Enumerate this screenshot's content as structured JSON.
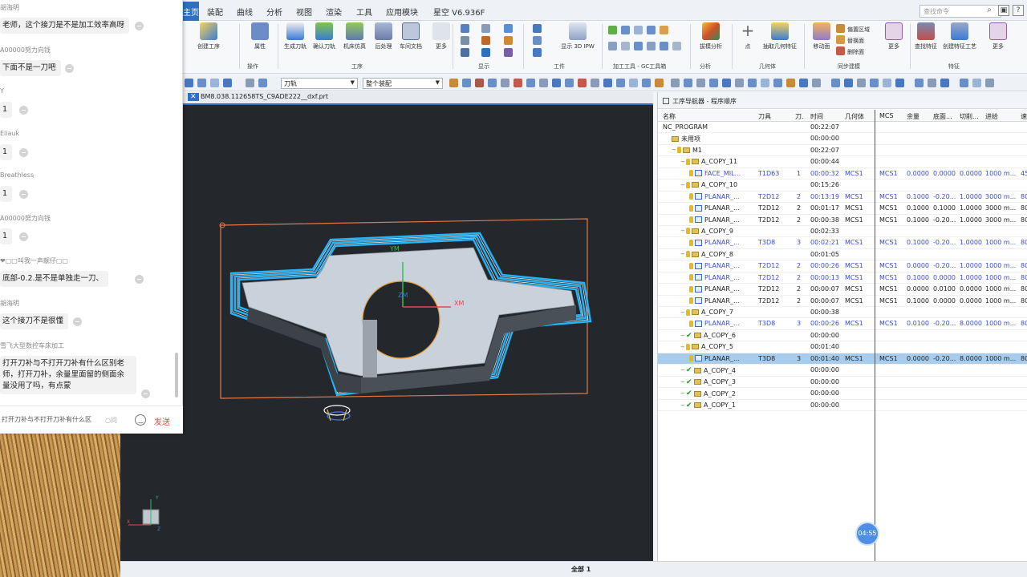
{
  "app": {
    "menu": [
      "主页",
      "装配",
      "曲线",
      "分析",
      "视图",
      "渲染",
      "工具",
      "应用模块",
      "星空 V6.936F"
    ],
    "search_placeholder": "查找命令",
    "ribbon_buttons": [
      "创建工序",
      "属性",
      "生成刀轨",
      "确认刀轨",
      "机床仿真",
      "后处理",
      "车间文档",
      "更多",
      "显示 3D IPW",
      "拔模分析",
      "点",
      "抽取几何特征",
      "移动面",
      "替换面",
      "删除面",
      "偏置区域",
      "更多",
      "查找特征",
      "创建特征工艺",
      "更多"
    ],
    "ribbon_groups": [
      "操作",
      "工序",
      "显示",
      "工件",
      "加工工具 - GC工具箱",
      "分析",
      "几何体",
      "同步建模",
      "特征"
    ],
    "toolbar_select_1": "刀轨",
    "toolbar_select_2": "整个装配",
    "doc_tab": "BM8.038.112658TS_C9ADE222__dxf.prt",
    "status": "全部 1",
    "timer": "04:55"
  },
  "navigator": {
    "title": "工序导航器 - 程序顺序",
    "columns": [
      "名称",
      "刀具",
      "刀.",
      "时间",
      "几何体",
      "MCS",
      "余量",
      "底面...",
      "切削...",
      "进给",
      "速"
    ],
    "rows": [
      {
        "name": "NC_PROGRAM",
        "lvl": 0,
        "icon": "none",
        "tool": "",
        "num": "",
        "time": "00:22:07",
        "geom": "",
        "mcs": "",
        "stock": "",
        "floor": "",
        "cut": "",
        "feed": "",
        "speed": ""
      },
      {
        "name": "未用项",
        "lvl": 1,
        "icon": "fold",
        "tool": "",
        "num": "",
        "time": "00:00:00",
        "geom": "",
        "mcs": "",
        "stock": "",
        "floor": "",
        "cut": "",
        "feed": "",
        "speed": ""
      },
      {
        "name": "M1",
        "lvl": 1,
        "icon": "keyfold",
        "tool": "",
        "num": "",
        "time": "00:22:07",
        "geom": "",
        "mcs": "",
        "stock": "",
        "floor": "",
        "cut": "",
        "feed": "",
        "speed": ""
      },
      {
        "name": "A_COPY_11",
        "lvl": 2,
        "icon": "keyfold",
        "tool": "",
        "num": "",
        "time": "00:00:44",
        "geom": "",
        "mcs": "",
        "stock": "",
        "floor": "",
        "cut": "",
        "feed": "",
        "speed": ""
      },
      {
        "name": "FACE_MIL...",
        "lvl": 3,
        "icon": "keyop",
        "blue": true,
        "tool": "T1D63",
        "num": "1",
        "time": "00:00:32",
        "geom": "MCS1",
        "mcs": "MCS1",
        "stock": "0.0000",
        "floor": "0.0000",
        "cut": "0.0000",
        "feed": "1000 m...",
        "speed": "45"
      },
      {
        "name": "A_COPY_10",
        "lvl": 2,
        "icon": "keyfold",
        "tool": "",
        "num": "",
        "time": "00:15:26",
        "geom": "",
        "mcs": "",
        "stock": "",
        "floor": "",
        "cut": "",
        "feed": "",
        "speed": ""
      },
      {
        "name": "PLANAR_...",
        "lvl": 3,
        "icon": "keyop",
        "blue": true,
        "tool": "T2D12",
        "num": "2",
        "time": "00:13:19",
        "geom": "MCS1",
        "mcs": "MCS1",
        "stock": "0.1000",
        "floor": "-0.20...",
        "cut": "1.0000",
        "feed": "3000 m...",
        "speed": "80"
      },
      {
        "name": "PLANAR_...",
        "lvl": 3,
        "icon": "keyop",
        "tool": "T2D12",
        "num": "2",
        "time": "00:01:17",
        "geom": "MCS1",
        "mcs": "MCS1",
        "stock": "0.1000",
        "floor": "0.1000",
        "cut": "1.0000",
        "feed": "3000 m...",
        "speed": "80"
      },
      {
        "name": "PLANAR_...",
        "lvl": 3,
        "icon": "keyop",
        "tool": "T2D12",
        "num": "2",
        "time": "00:00:38",
        "geom": "MCS1",
        "mcs": "MCS1",
        "stock": "0.1000",
        "floor": "-0.20...",
        "cut": "1.0000",
        "feed": "3000 m...",
        "speed": "80"
      },
      {
        "name": "A_COPY_9",
        "lvl": 2,
        "icon": "keyfold",
        "tool": "",
        "num": "",
        "time": "00:02:33",
        "geom": "",
        "mcs": "",
        "stock": "",
        "floor": "",
        "cut": "",
        "feed": "",
        "speed": ""
      },
      {
        "name": "PLANAR_...",
        "lvl": 3,
        "icon": "keyop",
        "blue": true,
        "tool": "T3D8",
        "num": "3",
        "time": "00:02:21",
        "geom": "MCS1",
        "mcs": "MCS1",
        "stock": "0.1000",
        "floor": "-0.20...",
        "cut": "1.0000",
        "feed": "1000 m...",
        "speed": "80"
      },
      {
        "name": "A_COPY_8",
        "lvl": 2,
        "icon": "keyfold",
        "tool": "",
        "num": "",
        "time": "00:01:05",
        "geom": "",
        "mcs": "",
        "stock": "",
        "floor": "",
        "cut": "",
        "feed": "",
        "speed": ""
      },
      {
        "name": "PLANAR_...",
        "lvl": 3,
        "icon": "keyop",
        "blue": true,
        "tool": "T2D12",
        "num": "2",
        "time": "00:00:26",
        "geom": "MCS1",
        "mcs": "MCS1",
        "stock": "0.0000",
        "floor": "-0.20...",
        "cut": "1.0000",
        "feed": "1000 m...",
        "speed": "80"
      },
      {
        "name": "PLANAR_...",
        "lvl": 3,
        "icon": "keyop",
        "blue": true,
        "tool": "T2D12",
        "num": "2",
        "time": "00:00:13",
        "geom": "MCS1",
        "mcs": "MCS1",
        "stock": "0.1000",
        "floor": "0.0000",
        "cut": "1.0000",
        "feed": "1000 m...",
        "speed": "80"
      },
      {
        "name": "PLANAR_...",
        "lvl": 3,
        "icon": "keyop",
        "tool": "T2D12",
        "num": "2",
        "time": "00:00:07",
        "geom": "MCS1",
        "mcs": "MCS1",
        "stock": "0.0000",
        "floor": "0.0100",
        "cut": "0.0000",
        "feed": "1000 m...",
        "speed": "80"
      },
      {
        "name": "PLANAR_...",
        "lvl": 3,
        "icon": "keyop",
        "tool": "T2D12",
        "num": "2",
        "time": "00:00:07",
        "geom": "MCS1",
        "mcs": "MCS1",
        "stock": "0.1000",
        "floor": "0.0000",
        "cut": "0.0000",
        "feed": "1000 m...",
        "speed": "80"
      },
      {
        "name": "A_COPY_7",
        "lvl": 2,
        "icon": "keyfold",
        "tool": "",
        "num": "",
        "time": "00:00:38",
        "geom": "",
        "mcs": "",
        "stock": "",
        "floor": "",
        "cut": "",
        "feed": "",
        "speed": ""
      },
      {
        "name": "PLANAR_...",
        "lvl": 3,
        "icon": "keyop",
        "blue": true,
        "tool": "T3D8",
        "num": "3",
        "time": "00:00:26",
        "geom": "MCS1",
        "mcs": "MCS1",
        "stock": "0.0100",
        "floor": "-0.20...",
        "cut": "8.0000",
        "feed": "1000 m...",
        "speed": "80"
      },
      {
        "name": "A_COPY_6",
        "lvl": 2,
        "icon": "chkfold",
        "tool": "",
        "num": "",
        "time": "00:00:00",
        "geom": "",
        "mcs": "",
        "stock": "",
        "floor": "",
        "cut": "",
        "feed": "",
        "speed": ""
      },
      {
        "name": "A_COPY_5",
        "lvl": 2,
        "icon": "keyfold",
        "tool": "",
        "num": "",
        "time": "00:01:40",
        "geom": "",
        "mcs": "",
        "stock": "",
        "floor": "",
        "cut": "",
        "feed": "",
        "speed": ""
      },
      {
        "name": "PLANAR_...",
        "lvl": 3,
        "icon": "keyop",
        "sel": true,
        "tool": "T3D8",
        "num": "3",
        "time": "00:01:40",
        "geom": "MCS1",
        "mcs": "MCS1",
        "stock": "0.0000",
        "floor": "-0.20...",
        "cut": "8.0000",
        "feed": "1000 m...",
        "speed": "80"
      },
      {
        "name": "A_COPY_4",
        "lvl": 2,
        "icon": "chkfold",
        "tool": "",
        "num": "",
        "time": "00:00:00",
        "geom": "",
        "mcs": "",
        "stock": "",
        "floor": "",
        "cut": "",
        "feed": "",
        "speed": ""
      },
      {
        "name": "A_COPY_3",
        "lvl": 2,
        "icon": "chkfold",
        "tool": "",
        "num": "",
        "time": "00:00:00",
        "geom": "",
        "mcs": "",
        "stock": "",
        "floor": "",
        "cut": "",
        "feed": "",
        "speed": ""
      },
      {
        "name": "A_COPY_2",
        "lvl": 2,
        "icon": "chkfold",
        "tool": "",
        "num": "",
        "time": "00:00:00",
        "geom": "",
        "mcs": "",
        "stock": "",
        "floor": "",
        "cut": "",
        "feed": "",
        "speed": ""
      },
      {
        "name": "A_COPY_1",
        "lvl": 2,
        "icon": "chkfold",
        "tool": "",
        "num": "",
        "time": "00:00:00",
        "geom": "",
        "mcs": "",
        "stock": "",
        "floor": "",
        "cut": "",
        "feed": "",
        "speed": ""
      }
    ]
  },
  "viewport": {
    "axis_ym": "YM",
    "axis_xm": "XM",
    "axis_zm": "ZM",
    "triad_y": "Y",
    "triad_x": "X",
    "triad_z": "Z"
  },
  "chat": {
    "messages": [
      {
        "name": "胡海明",
        "text": "老师，这个接刀是不是加工效率高呀"
      },
      {
        "name": "A00000努力向钱",
        "text": "下面不是一刀吧"
      },
      {
        "name": "Y",
        "text": "1"
      },
      {
        "name": "Eliauk",
        "text": "1"
      },
      {
        "name": "Breathless",
        "text": "1"
      },
      {
        "name": "A00000努力向钱",
        "text": "1"
      },
      {
        "name": "❤▢▢叫我一声靓仔▢▢",
        "text": "底部-0.2.是不是单独走一刀、"
      },
      {
        "name": "胡海明",
        "text": "这个接刀不是很懂"
      },
      {
        "name": "雪飞大型数控车床加工",
        "text": "打开刀补与不打开刀补有什么区别老师，打开刀补，余量里面留的侧面余量没用了吗，有点蒙"
      }
    ],
    "input_value": "打开刀补与不打开刀补有什么区",
    "send_label": "发送"
  }
}
